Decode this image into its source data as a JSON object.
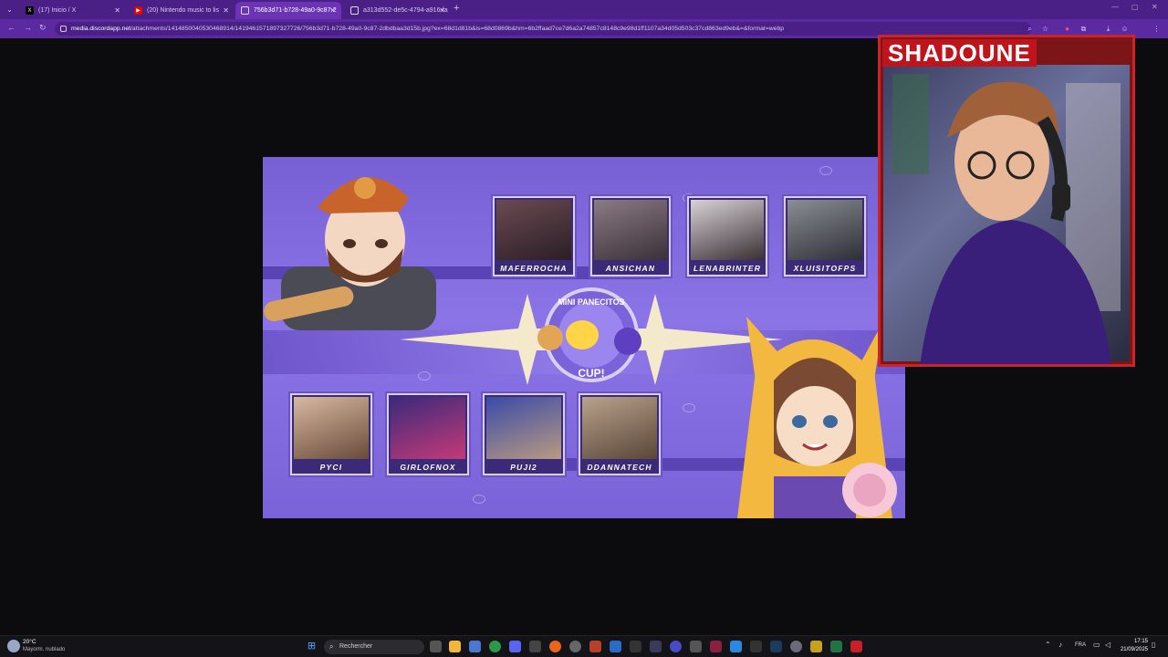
{
  "browser": {
    "tabs": [
      {
        "label": "(17) Inicio / X",
        "icon": "x-logo-icon"
      },
      {
        "label": "(20) Nintendo music to lis",
        "icon": "youtube-icon"
      },
      {
        "label": "756b3d71-b728-49a0-9c87-2",
        "icon": "globe-icon"
      },
      {
        "label": "a313d552-de5c-4794-a916-fa",
        "icon": "globe-icon"
      }
    ],
    "url_host": "media.discordapp.net",
    "url_path": "/attachments/1414850040530468914/1419461571897327726/756b3d71-b728-49a0-9c87-2dbdbaa3d15b.jpg?ex=68d1d81b&is=68d0869b&hm=6b2ffaad7ce7d6a2a74857c8148c9e98d1ff1107a34d05d503c37cd863ed9eb&=&format=webp"
  },
  "image": {
    "top_players": [
      "MAFERROCHA",
      "ANSICHAN",
      "LENABRINTER",
      "XLUISITOFPS"
    ],
    "bottom_players": [
      "PYCI",
      "GIRLOFNOX",
      "PUJI2",
      "DDANNATECH"
    ],
    "logo_top": "MINI PANECITOS",
    "logo_bottom": "CUP!"
  },
  "webcam": {
    "name": "SHADOUNE"
  },
  "taskbar": {
    "weather_temp": "20°C",
    "weather_desc": "Mayorm. nublado",
    "search_placeholder": "Rechercher",
    "lang": "FRA",
    "time": "17:15",
    "date": "21/09/2025"
  }
}
